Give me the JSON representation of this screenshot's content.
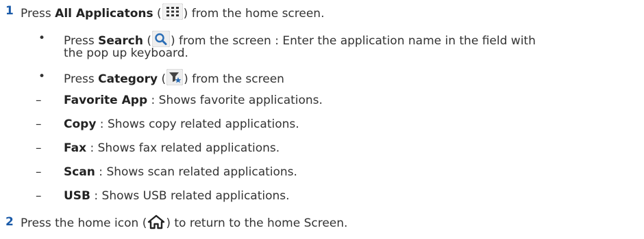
{
  "steps": [
    {
      "number": "1",
      "before": "Press ",
      "bold": "All Applicatons",
      "after_open": " (",
      "icon": "grid-icon",
      "after": ") from the home screen."
    },
    {
      "number": "2",
      "before": "Press the home icon (",
      "icon": "home-icon",
      "after": ") to return to the home Screen."
    }
  ],
  "bullets": [
    {
      "mark": "•",
      "before": "Press ",
      "bold": "Search",
      "after_open": " (",
      "icon": "search-icon",
      "after": ") from the screen : Enter the application name in the field with",
      "continuation": "the pop up keyboard."
    },
    {
      "mark": "•",
      "before": "Press ",
      "bold": "Category",
      "after_open": " (",
      "icon": "category-filter-icon",
      "after": ") from the screen"
    }
  ],
  "categories": [
    {
      "mark": "–",
      "bold": "Favorite App",
      "rest": " : Shows favorite applications."
    },
    {
      "mark": "–",
      "bold": "Copy",
      "rest": " : Shows copy related applications."
    },
    {
      "mark": "–",
      "bold": "Fax",
      "rest": " : Shows fax related applications."
    },
    {
      "mark": "–",
      "bold": "Scan",
      "rest": " : Shows scan related applications."
    },
    {
      "mark": "–",
      "bold": "USB",
      "rest": " : Shows USB related applications."
    }
  ],
  "colors": {
    "step_number": "#1a5aa8",
    "text": "#333333",
    "icon_grey": "#444444",
    "icon_blue": "#2a6db5"
  }
}
